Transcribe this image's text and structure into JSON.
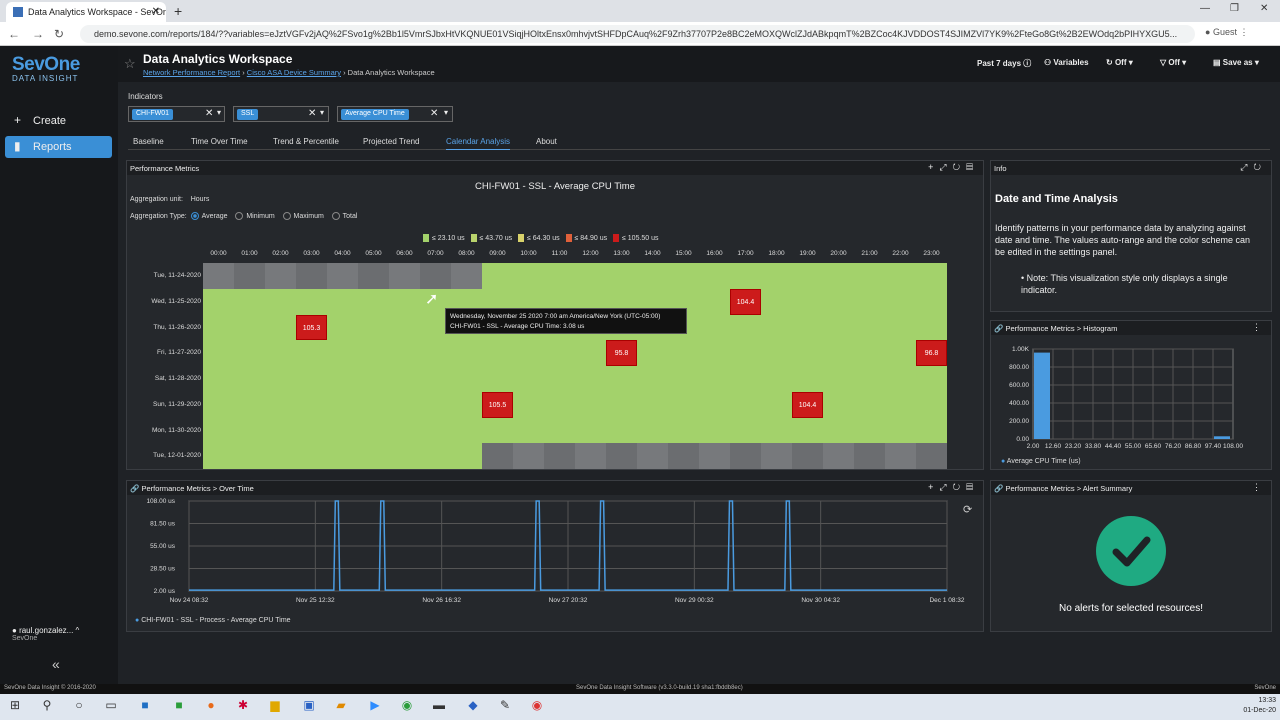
{
  "browser": {
    "tab_title": "Data Analytics Workspace - SevOne",
    "url": "demo.sevone.com/reports/184/??variables=eJztVGFv2jAQ%2FSvo1g%2Bb1l5VmrSJbxHtVKQNUE01VSiqjHOltxEnsx0mhvjvtSHFDpCAuq%2F9Zrh37707P2e8BC2eMOXQWclZJdABkpqmT%2BZCoc4KJVDDOST4SJIMZVl7YK9%2FteGo8Gt%2B2EWOdq2bPIHYXGU5...",
    "profile": "Guest"
  },
  "sidebar": {
    "brand_top": "SevOne",
    "brand_bottom": "DATA INSIGHT",
    "create": "Create",
    "reports": "Reports",
    "user": "raul.gonzalez...",
    "org": "SevOne"
  },
  "header": {
    "title": "Data Analytics Workspace",
    "crumb1": "Network Performance Report",
    "crumb2": "Cisco ASA Device Summary",
    "crumb3": "Data Analytics Workspace",
    "past": "Past 7 days",
    "variables": "Variables",
    "off1": "Off",
    "off2": "Off",
    "save": "Save as"
  },
  "indicators": {
    "label": "Indicators",
    "c1": "CHI-FW01",
    "c2": "SSL",
    "c3": "Average CPU Time"
  },
  "tabs": [
    "Baseline",
    "Time Over Time",
    "Trend & Percentile",
    "Projected Trend",
    "Calendar Analysis",
    "About"
  ],
  "perf": {
    "header": "Performance Metrics",
    "title": "CHI-FW01 - SSL - Average CPU Time",
    "agg_unit_label": "Aggregation unit:",
    "agg_unit": "Hours",
    "agg_type_label": "Aggregation Type:",
    "types": [
      "Average",
      "Minimum",
      "Maximum",
      "Total"
    ],
    "legend": [
      "≤ 23.10 us",
      "≤ 43.70 us",
      "≤ 64.30 us",
      "≤ 84.90 us",
      "≤ 105.50 us"
    ],
    "legend_colors": [
      "#a3d26b",
      "#b9d36c",
      "#d8d26b",
      "#e0603a",
      "#cc1b1b"
    ],
    "hours": [
      "00:00",
      "01:00",
      "02:00",
      "03:00",
      "04:00",
      "05:00",
      "06:00",
      "07:00",
      "08:00",
      "09:00",
      "10:00",
      "11:00",
      "12:00",
      "13:00",
      "14:00",
      "15:00",
      "16:00",
      "17:00",
      "18:00",
      "19:00",
      "20:00",
      "21:00",
      "22:00",
      "23:00"
    ],
    "days": [
      "Tue, 11-24-2020",
      "Wed, 11-25-2020",
      "Thu, 11-26-2020",
      "Fri, 11-27-2020",
      "Sat, 11-28-2020",
      "Sun, 11-29-2020",
      "Mon, 11-30-2020",
      "Tue, 12-01-2020"
    ],
    "highs": [
      {
        "d": 1,
        "h": 17,
        "v": "104.4"
      },
      {
        "d": 2,
        "h": 3,
        "v": "105.3"
      },
      {
        "d": 3,
        "h": 13,
        "v": "95.8"
      },
      {
        "d": 3,
        "h": 23,
        "v": "96.8"
      },
      {
        "d": 5,
        "h": 9,
        "v": "105.5"
      },
      {
        "d": 5,
        "h": 19,
        "v": "104.4"
      }
    ],
    "tooltip1": "Wednesday, November 25 2020 7:00 am America/New York (UTC-05:00)",
    "tooltip2": "CHI-FW01 - SSL - Average CPU Time: 3.08 us"
  },
  "info": {
    "header": "Info",
    "title": "Date and Time Analysis",
    "text": "Identify patterns in your performance data by analyzing against date and time. The values auto-range and the color scheme can be edited in the settings panel.",
    "note": "Note: This visualization style only displays a single indicator."
  },
  "histogram": {
    "header": "Performance Metrics > Histogram",
    "legend": "Average CPU Time (us)"
  },
  "overtime": {
    "header": "Performance Metrics > Over Time",
    "legend": "CHI-FW01 - SSL - Process - Average CPU Time"
  },
  "alert": {
    "header": "Performance Metrics > Alert Summary",
    "text": "No alerts for selected resources!"
  },
  "status": {
    "left": "SevOne Data Insight © 2016-2020",
    "center": "SevOne Data Insight Software (v3.3.0-build.19 sha1:fbddb8ec)",
    "right": "SevOne"
  },
  "clock": {
    "time": "13:33",
    "date": "01-Dec-20"
  },
  "chart_data": [
    {
      "type": "bar",
      "title": "Performance Metrics > Histogram",
      "categories": [
        "2.00",
        "12.60",
        "23.20",
        "33.80",
        "44.40",
        "55.00",
        "65.60",
        "76.20",
        "86.80",
        "97.40",
        "108.00"
      ],
      "series": [
        {
          "name": "Average CPU Time (us)",
          "values": [
            960,
            0,
            0,
            0,
            0,
            0,
            0,
            0,
            0,
            0,
            30
          ]
        }
      ],
      "ylim": [
        0,
        1000
      ],
      "ytick_labels": [
        "0.00",
        "200.00",
        "400.00",
        "600.00",
        "800.00",
        "1.00K"
      ]
    },
    {
      "type": "line",
      "title": "Performance Metrics > Over Time",
      "x": [
        "Nov 24 08:32",
        "Nov 25 12:32",
        "Nov 26 16:32",
        "Nov 27 20:32",
        "Nov 29 00:32",
        "Nov 30 04:32",
        "Dec 1 08:32"
      ],
      "ytick_labels": [
        "2.00 us",
        "28.50 us",
        "55.00 us",
        "81.50 us",
        "108.00 us"
      ],
      "ylim": [
        2,
        108
      ],
      "series": [
        {
          "name": "CHI-FW01 - SSL - Process - Average CPU Time",
          "baseline": 3,
          "spike_positions": [
            0.195,
            0.255,
            0.46,
            0.545,
            0.715,
            0.79
          ]
        }
      ]
    }
  ]
}
